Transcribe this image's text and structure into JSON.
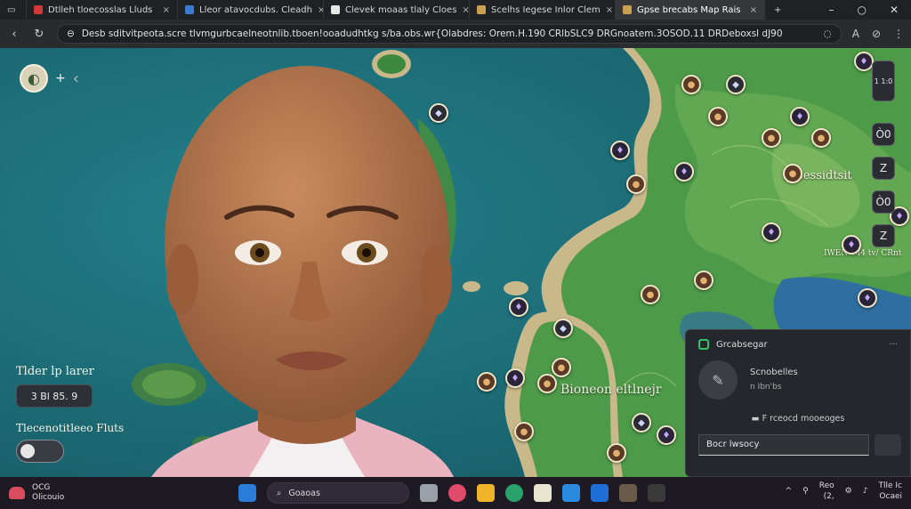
{
  "browser": {
    "tabs": [
      {
        "label": "Dtlleh tloecosslas Lluds",
        "favicon_color": "#d23a3a",
        "active": false
      },
      {
        "label": "Lleor atavocdubs. Cleadh",
        "favicon_color": "#3a7bd2",
        "active": false
      },
      {
        "label": "Clevek moaas tlaly Cloes",
        "favicon_color": "#e6e6e6",
        "active": false
      },
      {
        "label": "Scelhs Iegese Inlor Clem",
        "favicon_color": "#c8a050",
        "active": false
      },
      {
        "label": "Gpse brecabs Map Rais",
        "favicon_color": "#c8a050",
        "active": true
      }
    ],
    "address": "Desb sditvitpeota.scre tlvmgurbcaelneotnlib.tboen!ooadudhtkg s/ba.obs.wr{Olabdres: Orem.H.190 CRlbSLC9 DRGnoatem.3OSOD.11 DRDeboxsl dJ90",
    "new_tab": "+"
  },
  "map": {
    "labels": {
      "east_region": "Essessidtsit",
      "south_region": "Bioneon eltlnejr",
      "ne_small": "IWEN",
      "e_small": "M4 tv/ CRnt"
    }
  },
  "left_panel": {
    "title": "Tlder lp larer",
    "chip_value": "3 Bl 85. 9",
    "toggle_label": "Tlecenotitleeo Fluts"
  },
  "right_controls": {
    "top": "1 1:0",
    "c1": "Ò0",
    "c2": "Z",
    "c3": "Ò0",
    "c4": "Z"
  },
  "popup": {
    "title": "Grcabsegar",
    "name": "Scnobelles",
    "subtitle": "n  Ibn'bs",
    "note": "F rceocd mooeoges",
    "input_placeholder": "Bocr lwsocy"
  },
  "taskbar": {
    "weather_temp": "OCG",
    "weather_desc": "Olicouio",
    "search_text": "Goaoas",
    "clock_time": "Reo",
    "clock_date": "(2,",
    "tray_right_top": "Tlle Ic",
    "tray_right_bottom": "Ocaei"
  }
}
